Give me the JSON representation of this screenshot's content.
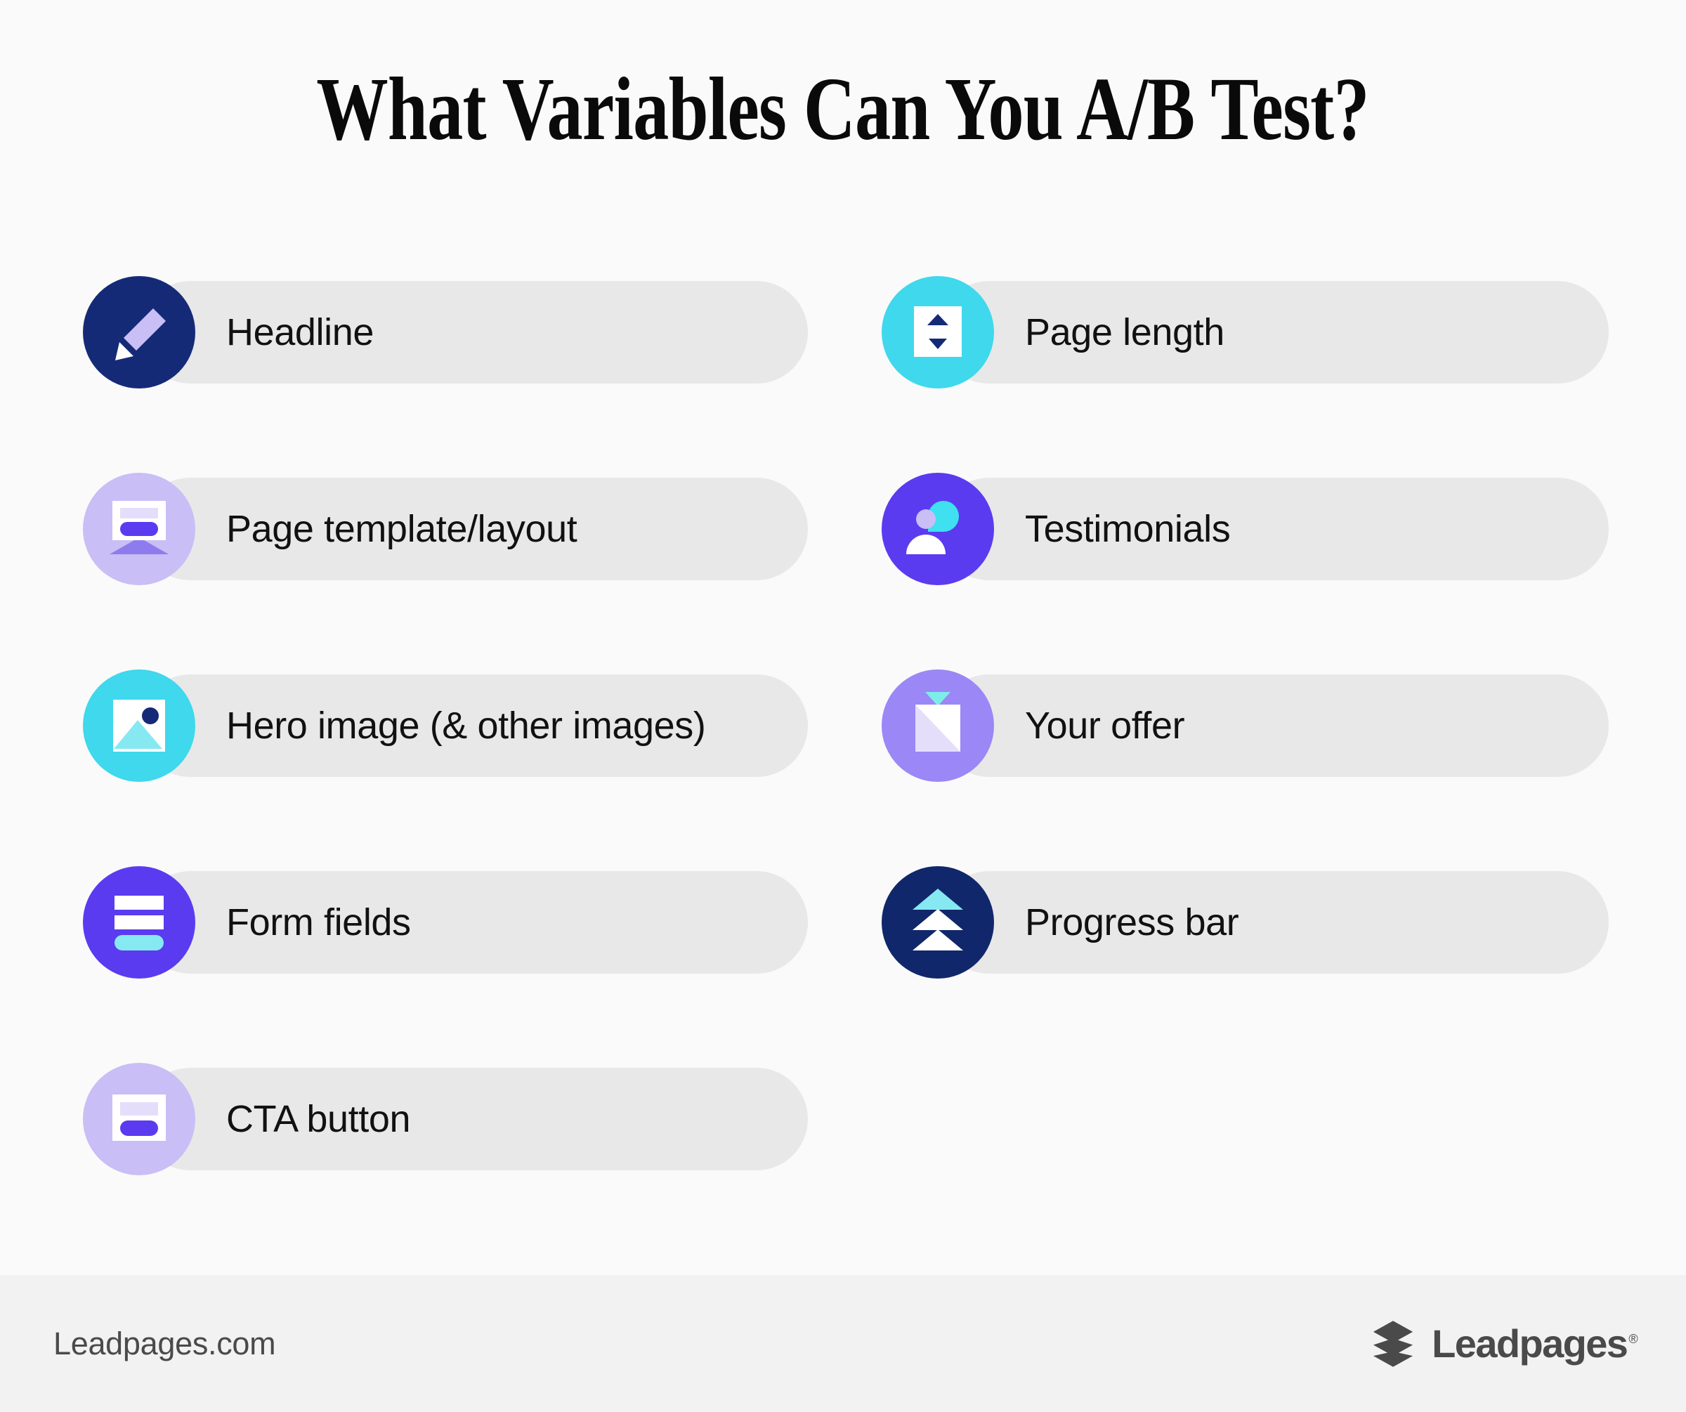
{
  "page": {
    "title": "What Variables Can You A/B Test?",
    "background_color": "#FAFAFA",
    "pill_color": "#E8E8E8",
    "text_color": "#111111"
  },
  "palette": {
    "navy": "#152A77",
    "navy_deep": "#11276B",
    "purple": "#5B3BF0",
    "purple_light": "#9B87F5",
    "lavender": "#C9BEF5",
    "lavender_pale": "#E5DEFB",
    "cyan": "#3FD8EC",
    "cyan_light": "#86E9F2",
    "white": "#FFFFFF",
    "footer_text": "#4A4A4A",
    "footer_bg": "#F2F2F2"
  },
  "items": {
    "left": [
      {
        "label": "Headline",
        "icon": "pencil-icon",
        "circle_color": "#152A77"
      },
      {
        "label": "Page template/layout",
        "icon": "page-layout-icon",
        "circle_color": "#C9BEF5"
      },
      {
        "label": "Hero image (& other images)",
        "icon": "image-icon",
        "circle_color": "#3FD8EC"
      },
      {
        "label": "Form fields",
        "icon": "form-fields-icon",
        "circle_color": "#5B3BF0"
      },
      {
        "label": "CTA button",
        "icon": "cta-button-icon",
        "circle_color": "#C9BEF5"
      }
    ],
    "right": [
      {
        "label": "Page length",
        "icon": "updown-arrows-icon",
        "circle_color": "#3FD8EC"
      },
      {
        "label": "Testimonials",
        "icon": "person-speech-icon",
        "circle_color": "#5B3BF0"
      },
      {
        "label": "Your offer",
        "icon": "gift-box-icon",
        "circle_color": "#9B87F5"
      },
      {
        "label": "Progress bar",
        "icon": "chevrons-up-icon",
        "circle_color": "#11276B"
      }
    ]
  },
  "footer": {
    "site": "Leadpages.com",
    "brand": "Leadpages",
    "registered_mark": "®",
    "logo_icon": "leadpages-layers-logo"
  }
}
